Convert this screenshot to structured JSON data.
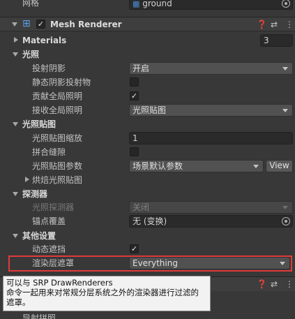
{
  "top_row": {
    "label": "网格",
    "value": "ground",
    "mesh_icon": "mesh-grid-icon"
  },
  "component": {
    "title": "Mesh Renderer",
    "enabled_mark": "✓",
    "icons": [
      "mesh-renderer-icon",
      "help-icon",
      "preset-icon",
      "more-icon"
    ]
  },
  "materials": {
    "label": "Materials",
    "count": "3"
  },
  "lighting": {
    "header": "光照",
    "cast_shadows": {
      "label": "投射阴影",
      "value": "开启"
    },
    "static_shadow_caster": {
      "label": "静态阴影投射物"
    },
    "contribute_gi": {
      "label": "贡献全局照明",
      "mark": "✓"
    },
    "receive_gi": {
      "label": "接收全局照明",
      "value": "光照贴图"
    }
  },
  "lightmapping": {
    "header": "光照贴图",
    "scale": {
      "label": "光照贴图缩放",
      "value": "1"
    },
    "stitch_seams": {
      "label": "拼合缝隙"
    },
    "parameters": {
      "label": "光照贴图参数",
      "value": "场景默认参数",
      "button": "View"
    },
    "baked_lightmap": {
      "label": "烘焙光照贴图"
    }
  },
  "probes": {
    "header": "探测器",
    "light_probes": {
      "label": "光照探测器",
      "value": "关闭"
    },
    "anchor_override": {
      "label": "锚点覆盖",
      "value": "无 (变换)"
    }
  },
  "additional": {
    "header": "其他设置",
    "dynamic_occlusion": {
      "label": "动态遮挡",
      "mark": "✓"
    },
    "rendering_layer_mask": {
      "label": "渲染层遮罩",
      "value": "Everything"
    }
  },
  "tooltip": {
    "line1": "可以与 SRP DrawRenderers",
    "line2": "命令一起用来对常规分层系统之外的渲染器进行过滤的",
    "line3": "遮罩。"
  },
  "partial_row": {
    "label": "导射拼照"
  },
  "colors": {
    "highlight": "#e23a3a",
    "background": "#383838",
    "accent": "#4a8ad4"
  }
}
